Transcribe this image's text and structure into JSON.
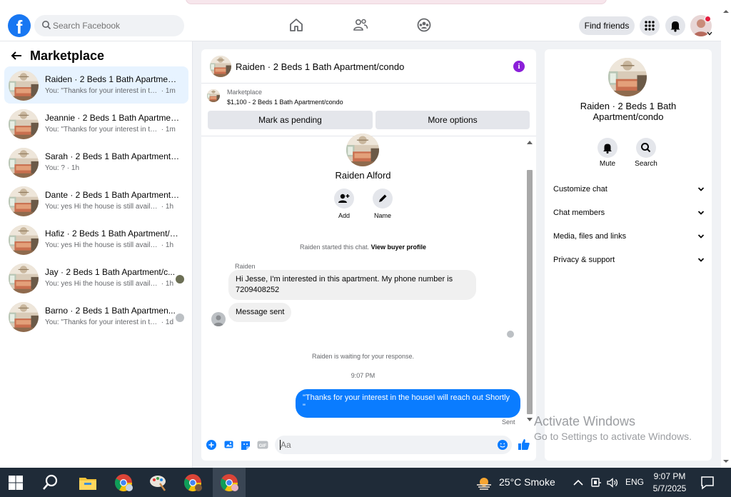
{
  "header": {
    "search_placeholder": "Search Facebook",
    "find_friends": "Find friends"
  },
  "sidebar": {
    "title": "Marketplace",
    "conversations": [
      {
        "name": "Raiden · 2 Beds 1 Bath Apartment/...",
        "preview": "You: \"Thanks for your interest in the ...",
        "time": "· 1m",
        "active": true
      },
      {
        "name": "Jeannie · 2 Beds 1 Bath Apartment...",
        "preview": "You: \"Thanks for your interest in the ...",
        "time": "· 1m"
      },
      {
        "name": "Sarah · 2 Beds 1 Bath Apartment/c...",
        "preview": "You: ?",
        "time": "· 1h"
      },
      {
        "name": "Dante · 2 Beds 1 Bath Apartment/c...",
        "preview": "You: yes Hi the house is still available ...",
        "time": "· 1h"
      },
      {
        "name": "Hafiz · 2 Beds 1 Bath Apartment/c...",
        "preview": "You: yes Hi the house is still available ...",
        "time": "· 1h"
      },
      {
        "name": "Jay · 2 Beds 1 Bath Apartment/c...",
        "preview": "You: yes Hi the house is still availab...",
        "time": "· 1h"
      },
      {
        "name": "Barno · 2 Beds 1 Bath Apartmen...",
        "preview": "You: \"Thanks for your interest in th...",
        "time": "· 1d"
      }
    ]
  },
  "chat": {
    "title": "Raiden · 2 Beds 1 Bath Apartment/condo",
    "listing_source": "Marketplace",
    "listing_price": "$1,100 - 2 Beds 1 Bath Apartment/condo",
    "mark_pending": "Mark as pending",
    "more_options": "More options",
    "person_name": "Raiden Alford",
    "add_label": "Add",
    "name_label": "Name",
    "started_text": "Raiden started this chat.",
    "view_profile": "View buyer profile",
    "sender": "Raiden",
    "msg1": "Hi Jesse, I'm interested in this apartment. My phone number is 7209408252",
    "msg2": "Message sent",
    "waiting": "Raiden is waiting for your response.",
    "time": "9:07 PM",
    "out_msg": "\"Thanks for your interest in the houseI will reach out Shortly \"",
    "sent": "Sent",
    "composer_placeholder": "Aa"
  },
  "rpanel": {
    "title": "Raiden · 2 Beds 1 Bath Apartment/condo",
    "mute": "Mute",
    "search": "Search",
    "sections": [
      "Customize chat",
      "Chat members",
      "Media, files and links",
      "Privacy & support"
    ]
  },
  "watermark": {
    "line1": "Activate Windows",
    "line2": "Go to Settings to activate Windows."
  },
  "taskbar": {
    "weather": "25°C  Smoke",
    "lang": "ENG",
    "time": "9:07 PM",
    "date": "5/7/2025"
  },
  "colors": {
    "brand": "#1877f2",
    "outgoing_bubble": "#0a7cff",
    "info": "#8b1fd9",
    "taskbar": "#1f2b38"
  }
}
